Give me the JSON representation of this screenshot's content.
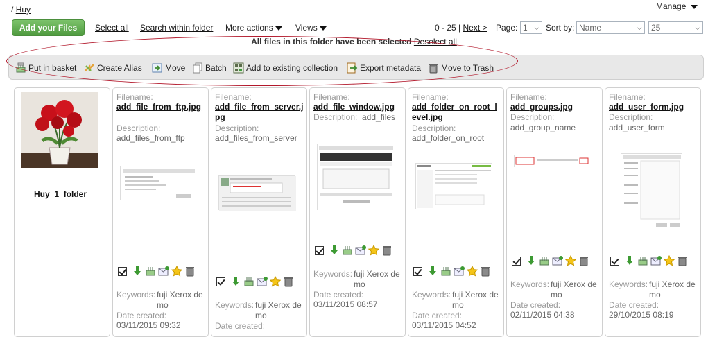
{
  "breadcrumb": {
    "sep": "/",
    "label": "Huy"
  },
  "manage_label": "Manage",
  "toolbar": {
    "add_files": "Add your Files",
    "select_all": "Select all",
    "search_within": "Search within folder",
    "more_actions": "More actions",
    "views": "Views"
  },
  "pager": {
    "range": "0 - 25 |",
    "next": "Next >",
    "page_label": "Page:",
    "page_value": "1",
    "sort_label": "Sort by:",
    "sort_value": "Name",
    "per_page": "25"
  },
  "notice": {
    "text": "All files in this folder have been selected",
    "deselect": "Deselect all"
  },
  "actions": {
    "put_in_basket": "Put in basket",
    "create_alias": "Create Alias",
    "move": "Move",
    "batch": "Batch",
    "add_collection": "Add to existing collection",
    "export_metadata": "Export metadata",
    "move_trash": "Move to Trash"
  },
  "folder": {
    "name": "Huy_1_folder"
  },
  "labels": {
    "filename": "Filename:",
    "description": "Description:",
    "keywords": "Keywords:",
    "date_created": "Date created:"
  },
  "files": [
    {
      "filename": "add_file_from_ftp.jpg",
      "description": "add_files_from_ftp",
      "keywords": "fuji Xerox demo",
      "date": "03/11/2015 09:32"
    },
    {
      "filename": "add_file_from_server.jpg",
      "description": "add_files_from_server",
      "keywords": "fuji Xerox demo",
      "date": ""
    },
    {
      "filename": "add_file_window.jpg",
      "description": "add_files",
      "keywords": "fuji Xerox demo",
      "date": "03/11/2015 08:57"
    },
    {
      "filename": "add_folder_on_root_level.jpg",
      "description": "add_folder_on_root",
      "keywords": "fuji Xerox demo",
      "date": "03/11/2015 04:52"
    },
    {
      "filename": "add_groups.jpg",
      "description": "add_group_name",
      "keywords": "fuji Xerox demo",
      "date": "02/11/2015 04:38"
    },
    {
      "filename": "add_user_form.jpg",
      "description": "add_user_form",
      "keywords": "fuji Xerox demo",
      "date": "29/10/2015 08:19"
    }
  ]
}
